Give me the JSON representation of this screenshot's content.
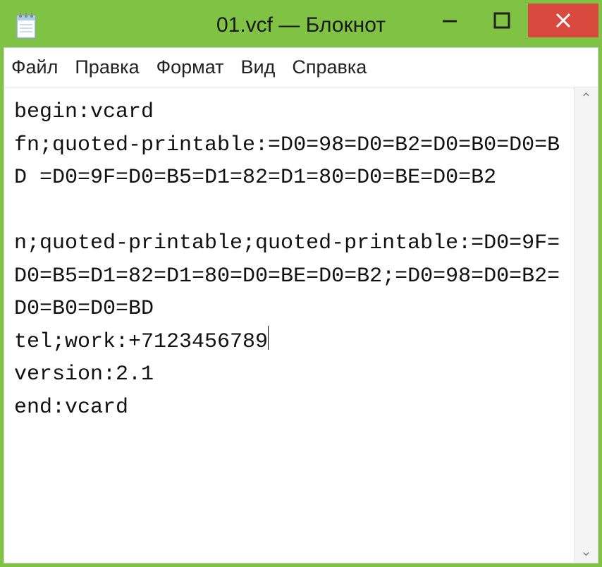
{
  "titlebar": {
    "icon_name": "notepad-icon",
    "title": "01.vcf — Блокнот"
  },
  "menubar": {
    "items": [
      "Файл",
      "Правка",
      "Формат",
      "Вид",
      "Справка"
    ]
  },
  "editor": {
    "content": "begin:vcard\nfn;quoted-printable:=D0=98=D0=B2=D0=B0=D0=BD =D0=9F=D0=B5=D1=82=D1=80=D0=BE=D0=B2\n\nn;quoted-printable;quoted-printable:=D0=9F=D0=B5=D1=82=D1=80=D0=BE=D0=B2;=D0=98=D0=B2=D0=B0=D0=BD\ntel;work:+7123456789",
    "content_after_cursor": "\nversion:2.1\nend:vcard"
  },
  "scroll": {
    "up_glyph": "⌃",
    "down_glyph": "⌄"
  }
}
